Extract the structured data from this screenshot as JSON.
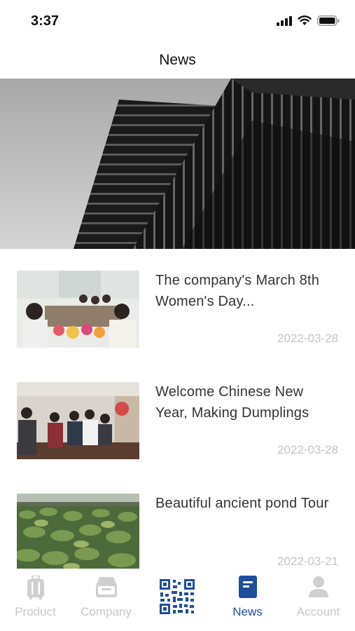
{
  "status": {
    "time": "3:37"
  },
  "header": {
    "title": "News"
  },
  "news": [
    {
      "title": "The company's March 8th Women's Day...",
      "date": "2022-03-28"
    },
    {
      "title": "Welcome Chinese New Year, Making Dumplings",
      "date": "2022-03-28"
    },
    {
      "title": "Beautiful ancient pond Tour",
      "date": "2022-03-21"
    }
  ],
  "tabs": [
    {
      "label": "Product",
      "icon": "suitcase-icon"
    },
    {
      "label": "Company",
      "icon": "inbox-icon"
    },
    {
      "label": "",
      "icon": "qr-code-icon"
    },
    {
      "label": "News",
      "icon": "book-icon",
      "active": true
    },
    {
      "label": "Account",
      "icon": "person-icon"
    }
  ],
  "colors": {
    "accent": "#1f4e9b",
    "inactive": "#c8c8c8",
    "date": "#c4c4c4"
  }
}
